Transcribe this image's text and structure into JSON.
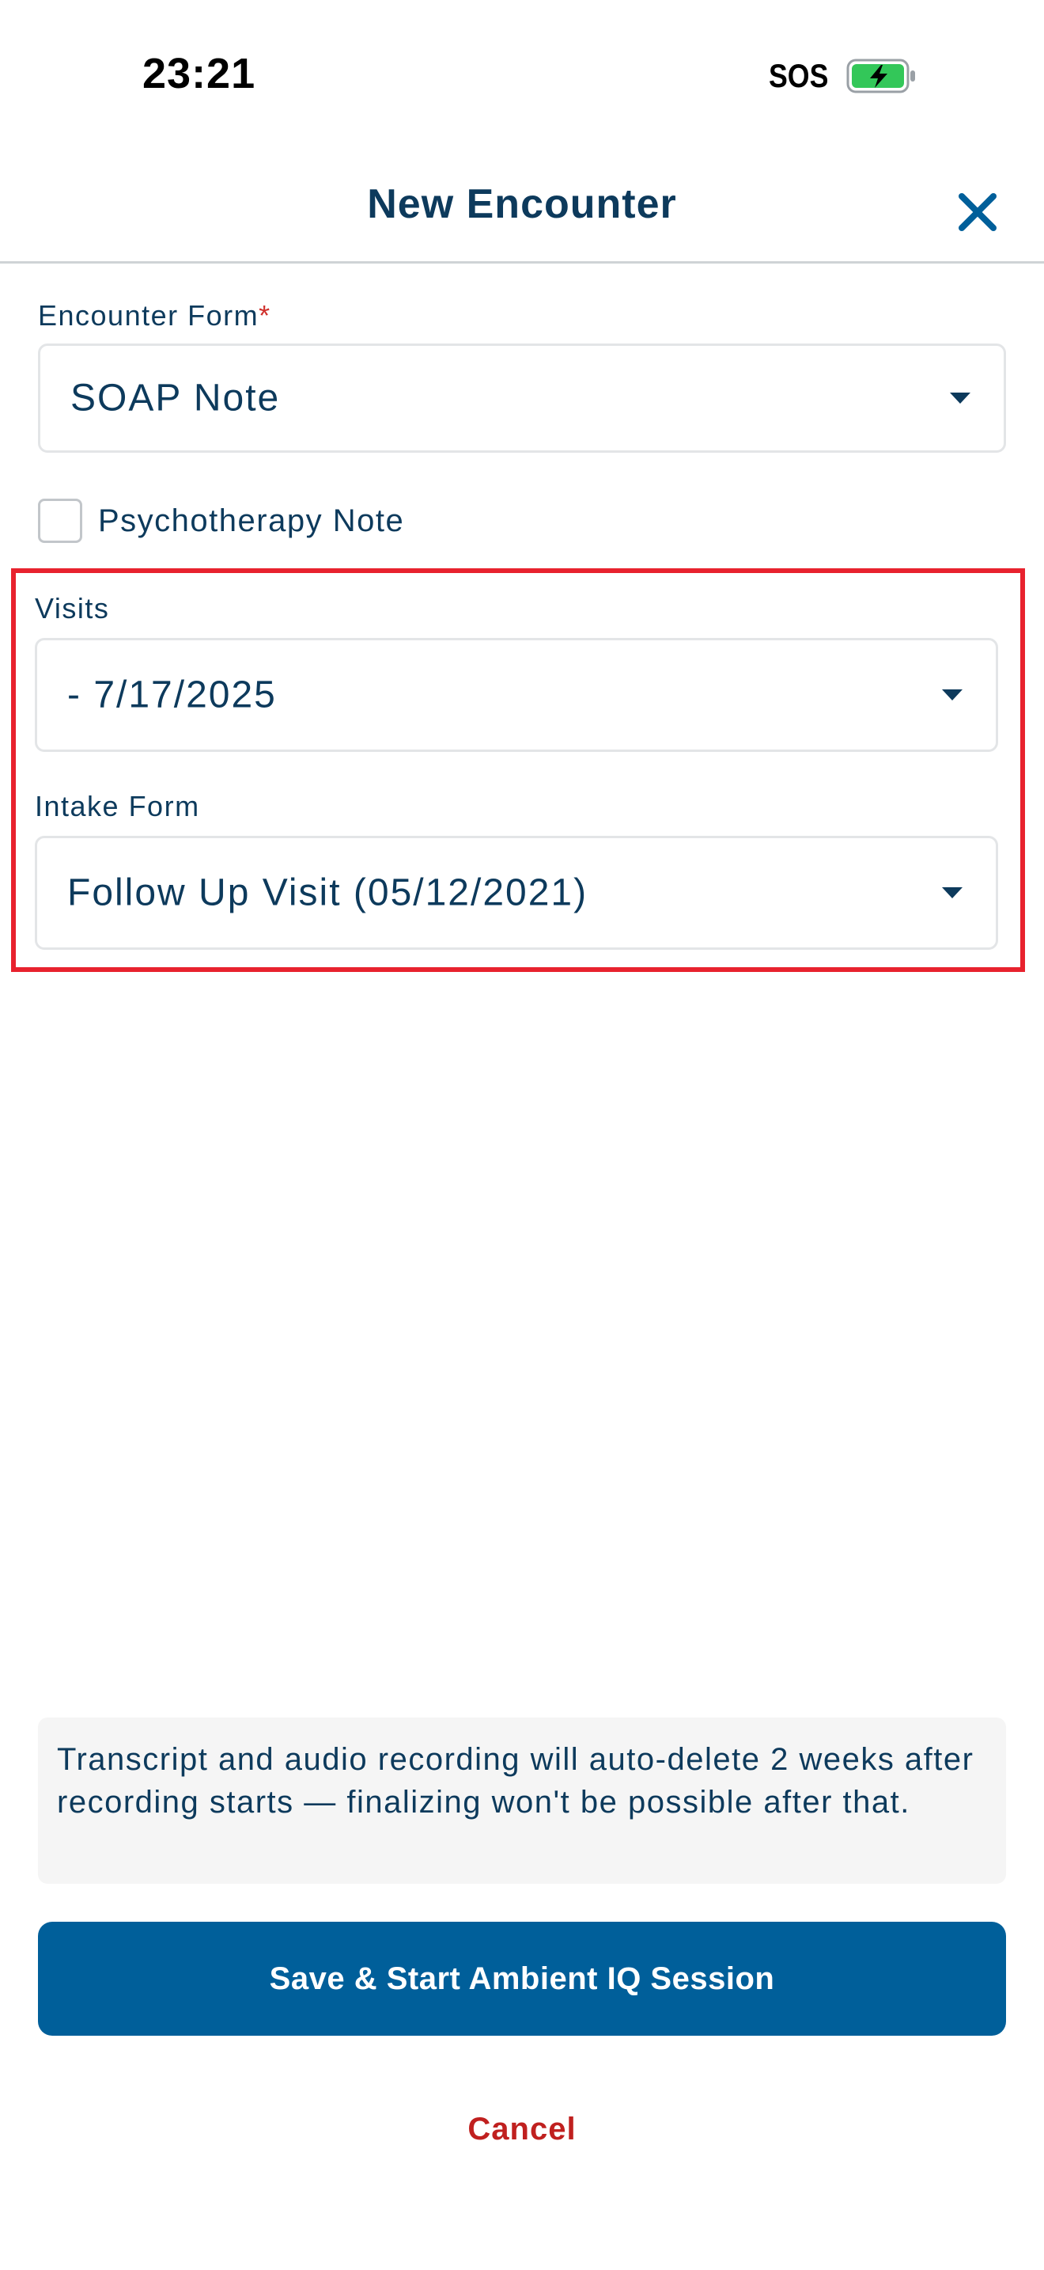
{
  "status_bar": {
    "time": "23:21",
    "carrier": "SOS",
    "battery_icon": "battery-charging-icon",
    "battery_color": "#33c759"
  },
  "header": {
    "title": "New Encounter",
    "close_icon": "close-icon"
  },
  "form": {
    "encounter_form": {
      "label": "Encounter Form",
      "required_marker": "*",
      "value": "SOAP Note"
    },
    "psychotherapy_note": {
      "label": "Psychotherapy Note",
      "checked": false
    },
    "visits": {
      "label": "Visits",
      "value": " - 7/17/2025"
    },
    "intake_form": {
      "label": "Intake Form",
      "value": "Follow Up Visit (05/12/2021)"
    }
  },
  "notice": {
    "text": "Transcript and audio recording will auto-delete 2 weeks after recording starts — finalizing won't be possible after that."
  },
  "actions": {
    "primary_label": "Save & Start Ambient IQ Session",
    "cancel_label": "Cancel"
  },
  "colors": {
    "primary": "#005f9a",
    "text": "#0d3a5c",
    "cancel": "#c0201f",
    "highlight": "#e8222e",
    "required": "#d0312d"
  }
}
